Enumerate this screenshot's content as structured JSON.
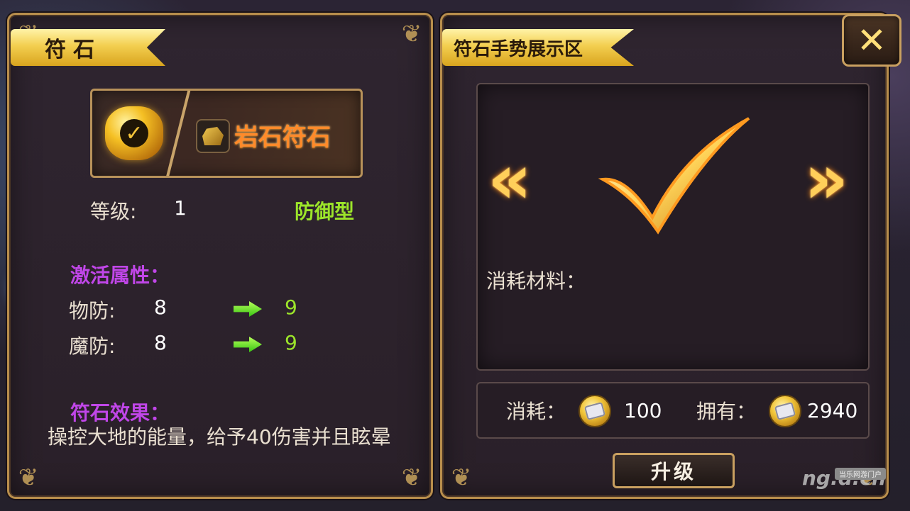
{
  "left_panel": {
    "title": "符石",
    "rune_name": "岩石符石",
    "level_label": "等级:",
    "level_value": "1",
    "rune_type": "防御型",
    "activate_attrs_title": "激活属性：",
    "attrs": [
      {
        "label": "物防:",
        "current": "8",
        "next": "9"
      },
      {
        "label": "魔防:",
        "current": "8",
        "next": "9"
      }
    ],
    "effect_title": "符石效果：",
    "effect_text": "操控大地的能量，给予40伤害并且眩晕"
  },
  "right_panel": {
    "title": "符石手势展示区",
    "prev_arrow": "«",
    "next_arrow": "»",
    "gesture_icon": "checkmark-gesture",
    "materials_label": "消耗材料：",
    "cost_label": "消耗：",
    "cost_value": "100",
    "owned_label": "拥有：",
    "owned_value": "2940",
    "upgrade_label": "升级",
    "close_label": "✕"
  },
  "watermark": {
    "logo": "ng.d.cn",
    "tag": "当乐网游门户"
  },
  "colors": {
    "panel_border": "#b88e4c",
    "title_ribbon": "#f3cf50",
    "rune_name": "#ff8a2a",
    "purple_heading": "#c046e8",
    "green_value": "#9ce52a"
  }
}
